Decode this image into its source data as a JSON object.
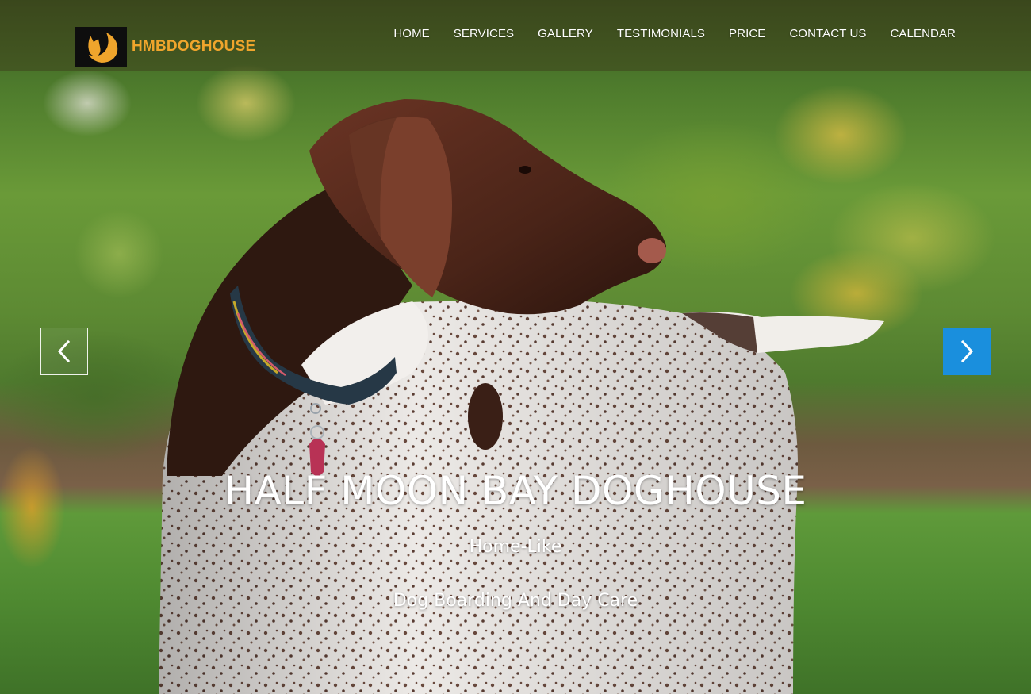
{
  "brand": {
    "name": "HMBDOGHOUSE",
    "accent_color": "#f0a52c",
    "logo_icon": "dog-moon-logo-icon"
  },
  "nav": {
    "items": [
      {
        "label": "HOME"
      },
      {
        "label": "SERVICES"
      },
      {
        "label": "GALLERY"
      },
      {
        "label": "TESTIMONIALS"
      },
      {
        "label": "PRICE"
      },
      {
        "label": "CONTACT US"
      },
      {
        "label": "CALENDAR"
      }
    ]
  },
  "carousel": {
    "prev_icon": "chevron-left-icon",
    "next_icon": "chevron-right-icon",
    "next_button_color": "#1a8fdd",
    "slide": {
      "title": "HALF MOON BAY DOGHOUSE",
      "subtitle": "Home-Like",
      "tagline": "Dog Boarding And Day Care"
    }
  }
}
